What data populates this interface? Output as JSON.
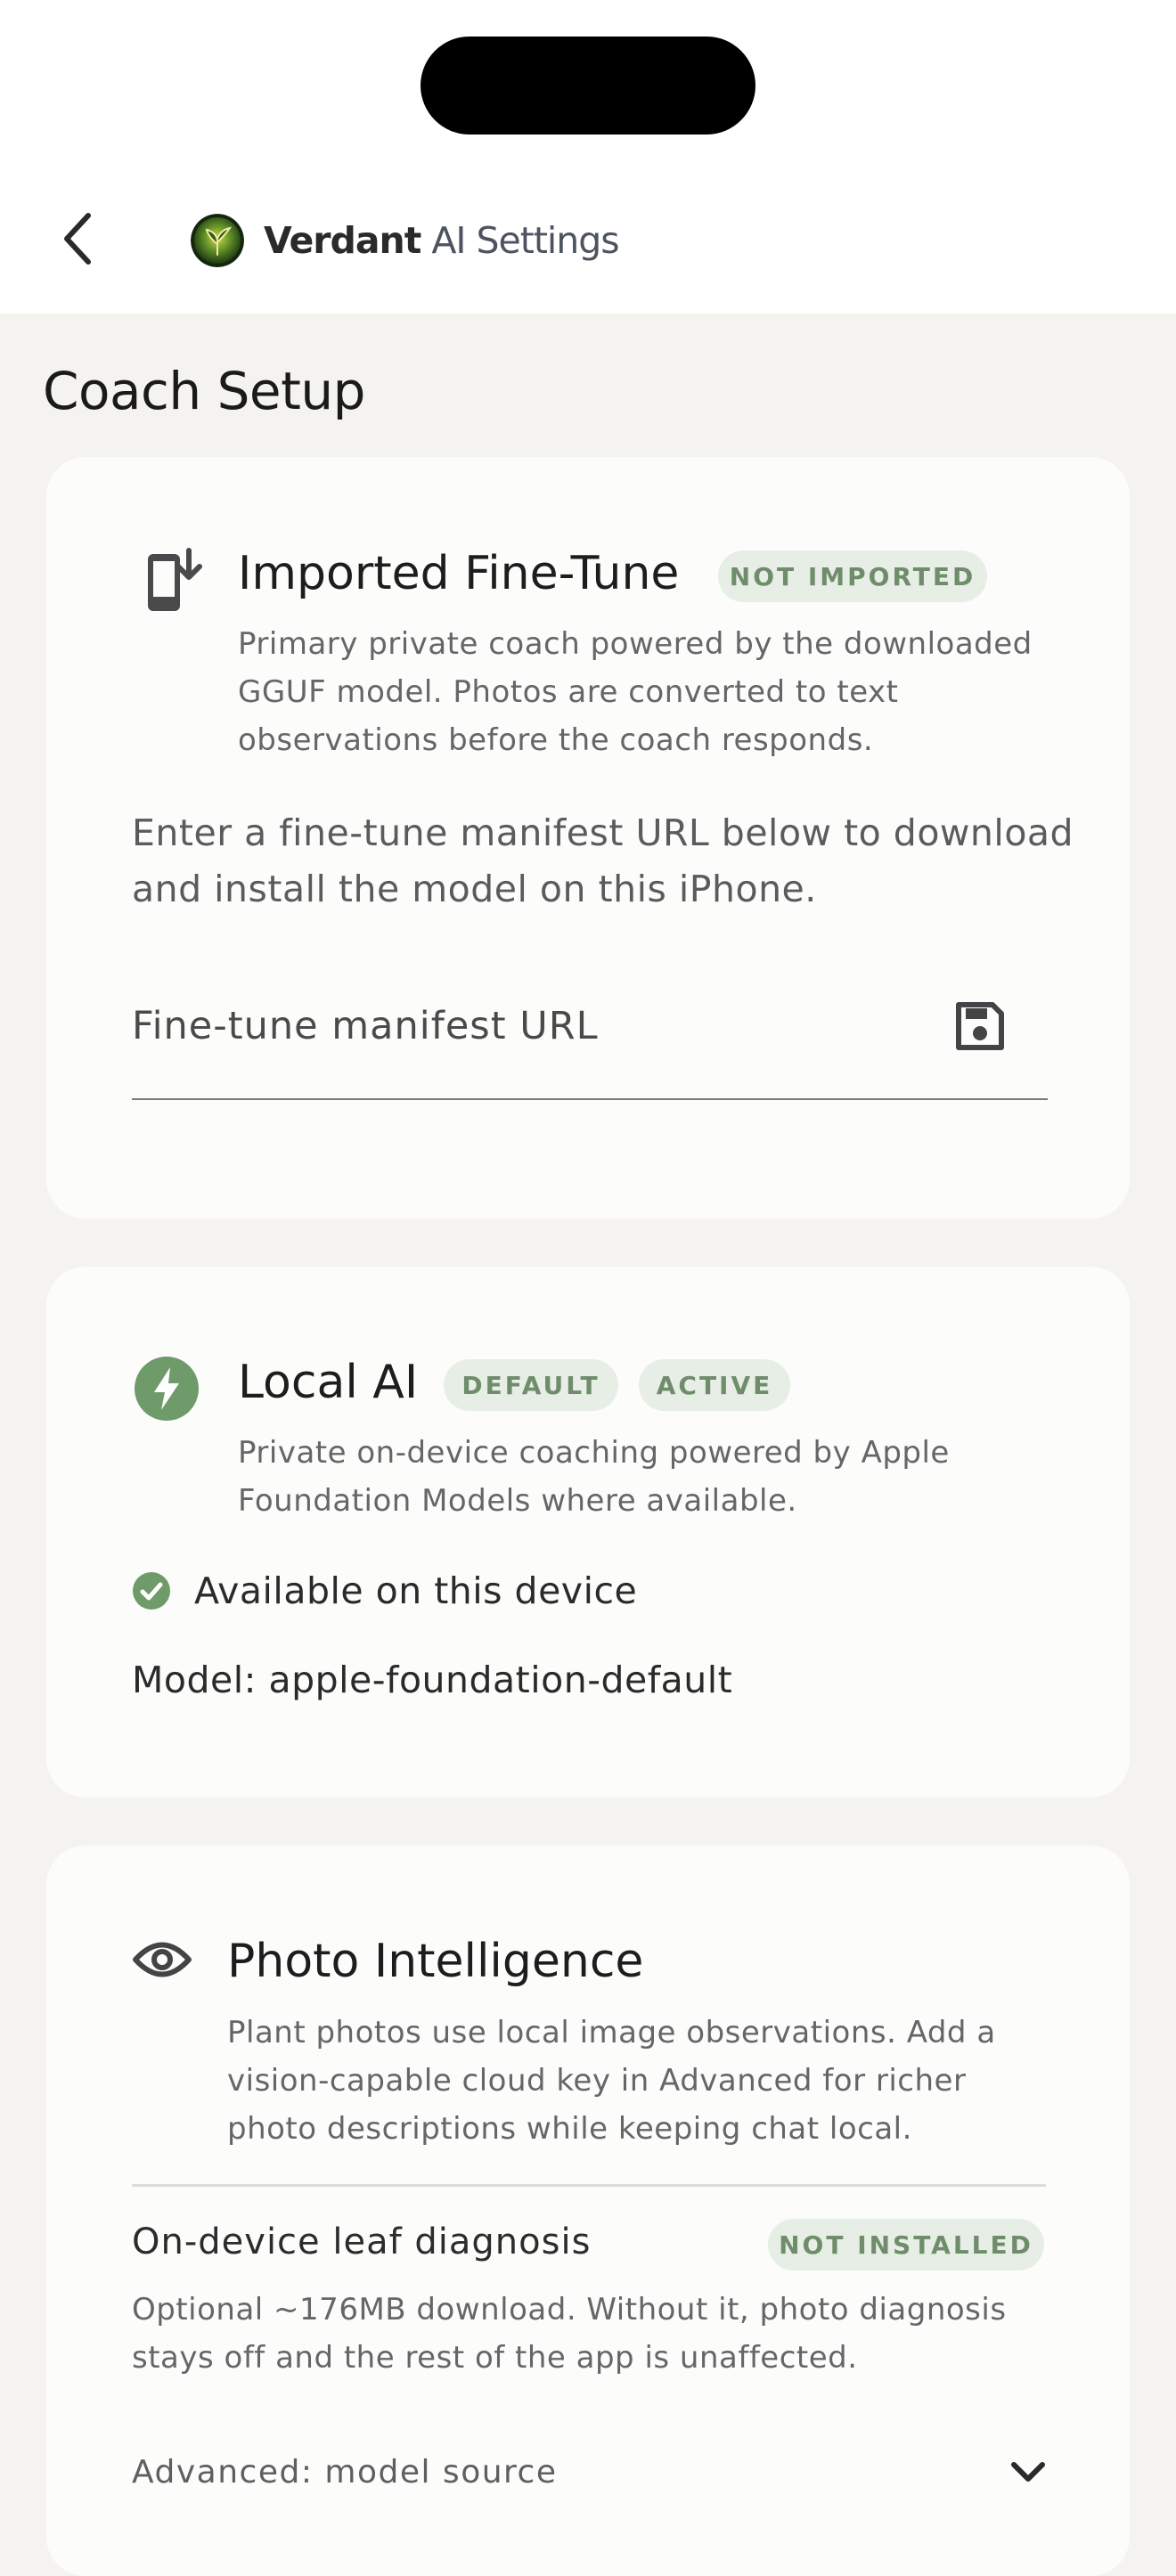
{
  "header": {
    "brand_name": "Verdant",
    "brand_suffix": "AI Settings",
    "icons": {
      "back": "chevron-left-icon",
      "logo": "verdant-logo"
    }
  },
  "page": {
    "section_title": "Coach Setup"
  },
  "fine_tune": {
    "title": "Imported Fine-Tune",
    "badge": "NOT IMPORTED",
    "icon": "phone-download-icon",
    "description": "Primary private coach powered by the downloaded GGUF model. Photos are converted to text observations before the coach responds.",
    "instructions": "Enter a fine-tune manifest URL below to download and install the model on this iPhone.",
    "url_placeholder": "Fine-tune manifest URL",
    "url_value": "",
    "save_icon": "save-icon"
  },
  "local_ai": {
    "title": "Local AI",
    "badges": [
      "DEFAULT",
      "ACTIVE"
    ],
    "icon": "bolt-icon",
    "description": "Private on-device coaching powered by Apple Foundation Models where available.",
    "availability": "Available on this device",
    "model_line": "Model: apple-foundation-default"
  },
  "photo_intel": {
    "title": "Photo Intelligence",
    "icon": "eye-icon",
    "description": "Plant photos use local image observations. Add a vision-capable cloud key in Advanced for richer photo descriptions while keeping chat local.",
    "leaf_title": "On-device leaf diagnosis",
    "leaf_badge": "NOT INSTALLED",
    "leaf_description": "Optional ~176MB download. Without it, photo diagnosis stays off and the rest of the app is unaffected.",
    "advanced_label": "Advanced: model source"
  },
  "colors": {
    "accent_green": "#6f9a6a",
    "badge_bg": "#e7eee5",
    "badge_text": "#6f8d6b",
    "page_bg": "#f4f3ef",
    "card_bg": "#fcfcfb"
  }
}
